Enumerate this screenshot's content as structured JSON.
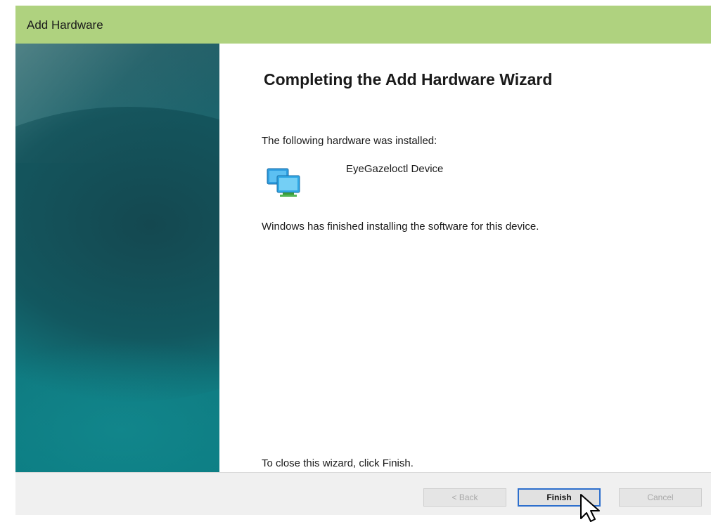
{
  "window": {
    "title": "Add Hardware"
  },
  "wizard": {
    "heading": "Completing the Add Hardware Wizard",
    "installed_label": "The following hardware was installed:",
    "device": {
      "name": "EyeGazeloctl Device",
      "icon": "monitor-device-icon"
    },
    "status": "Windows has finished installing the software for this device.",
    "close_hint": "To close this wizard, click Finish."
  },
  "buttons": {
    "back": "< Back",
    "finish": "Finish",
    "cancel": "Cancel"
  },
  "colors": {
    "titlebar": "#afd27f",
    "banner": "#1a6d75",
    "focus_border": "#2d6fcd"
  }
}
